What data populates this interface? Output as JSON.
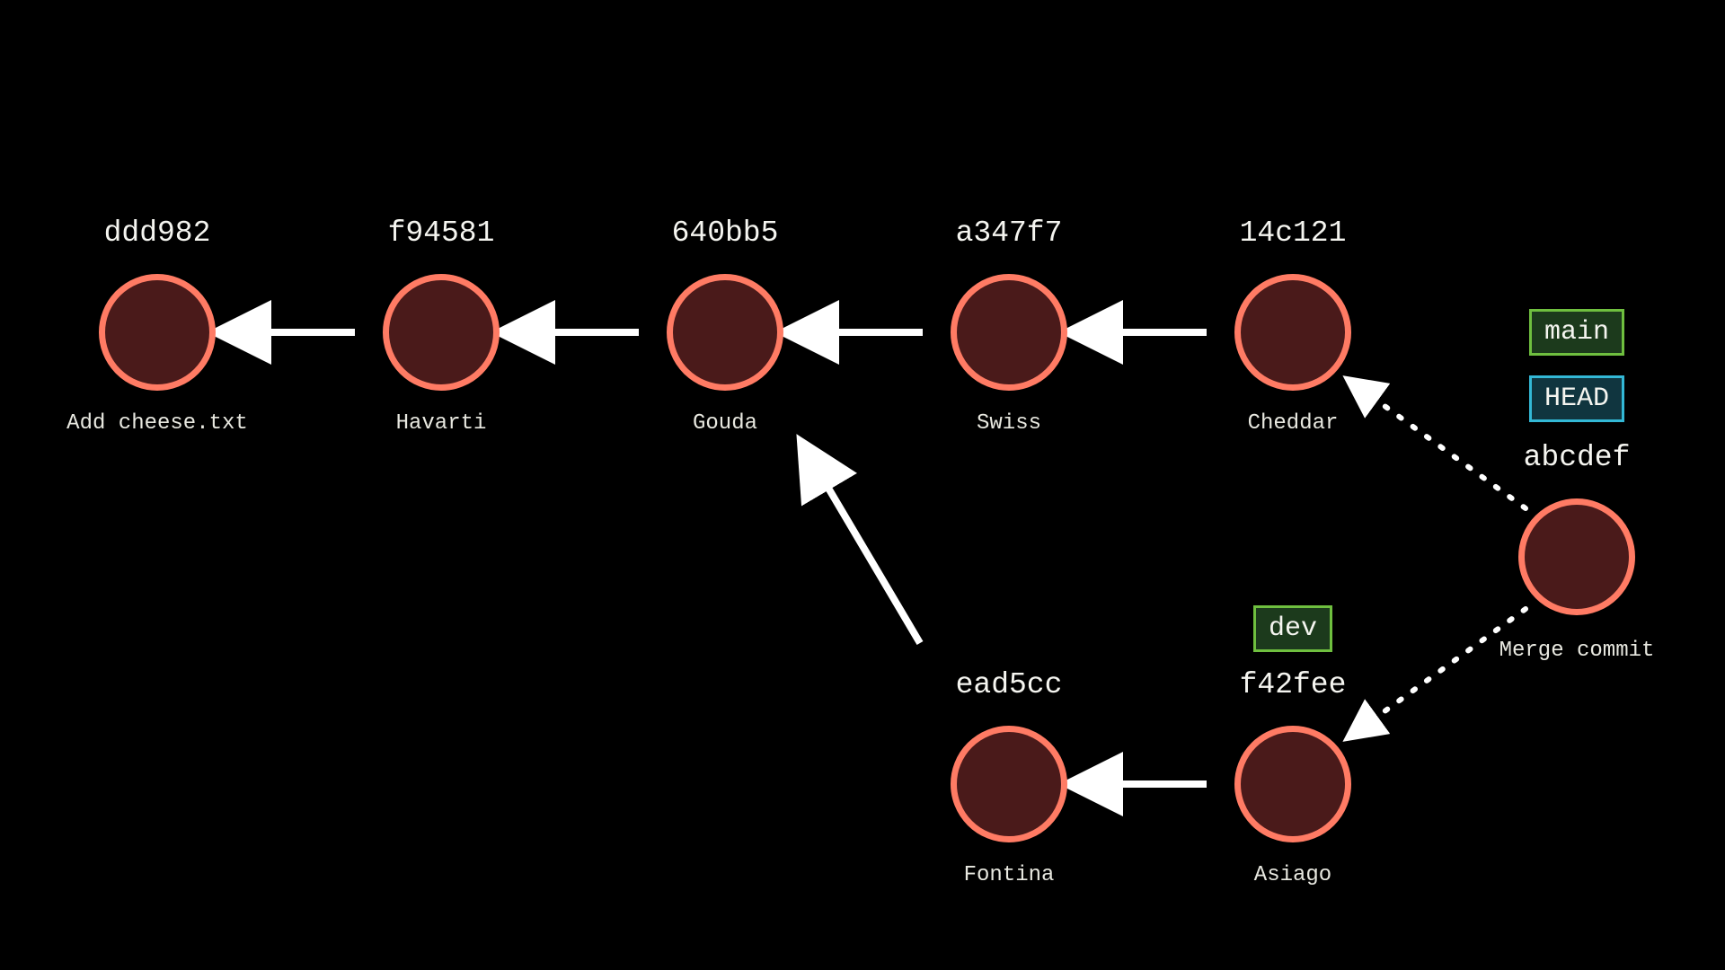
{
  "commits": {
    "c0": {
      "hash": "ddd982",
      "message": "Add cheese.txt"
    },
    "c1": {
      "hash": "f94581",
      "message": "Havarti"
    },
    "c2": {
      "hash": "640bb5",
      "message": "Gouda"
    },
    "c3": {
      "hash": "a347f7",
      "message": "Swiss"
    },
    "c4": {
      "hash": "14c121",
      "message": "Cheddar"
    },
    "c5": {
      "hash": "ead5cc",
      "message": "Fontina"
    },
    "c6": {
      "hash": "f42fee",
      "message": "Asiago"
    },
    "c7": {
      "hash": "abcdef",
      "message": "Merge commit"
    }
  },
  "refs": {
    "main": "main",
    "head": "HEAD",
    "dev": "dev"
  },
  "colors": {
    "node_fill": "#4a1a1a",
    "node_border": "#ff7b64",
    "branch_border": "#6fbf3f",
    "branch_fill": "#1c3a1c",
    "head_border": "#33b8d6",
    "head_fill": "#10353f",
    "arrow": "#ffffff"
  }
}
